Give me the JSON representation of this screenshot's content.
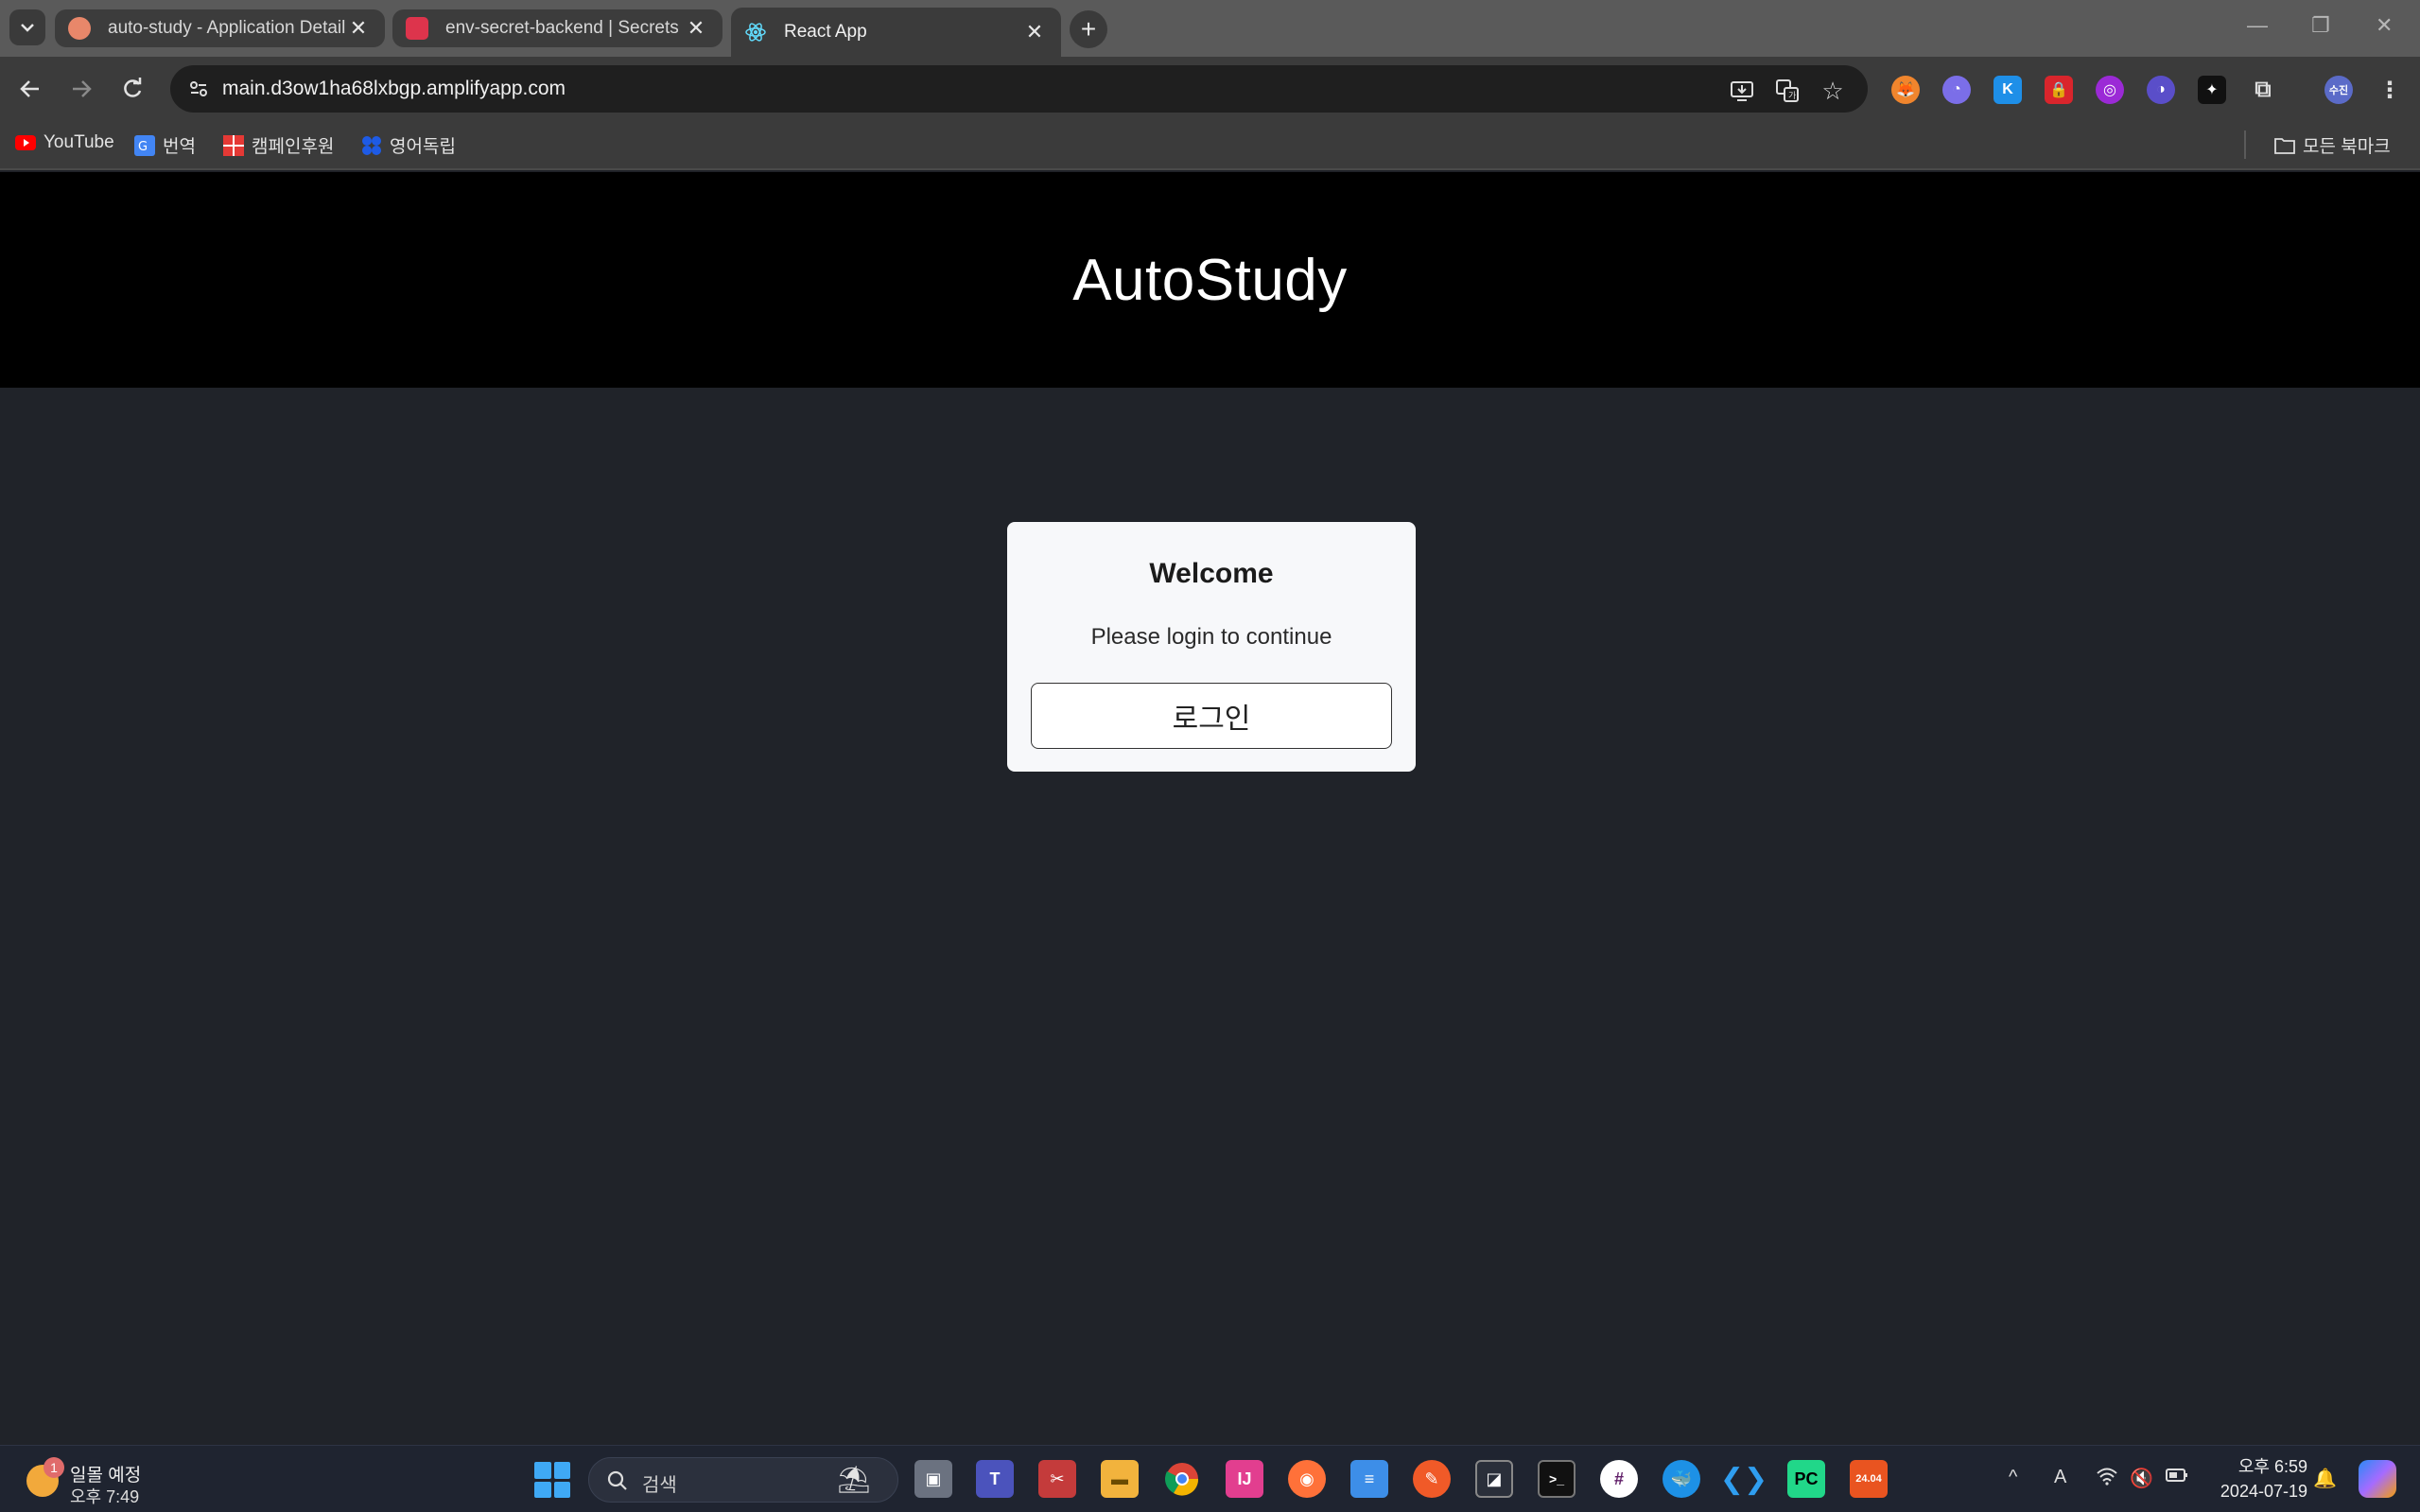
{
  "browser": {
    "tabs": [
      {
        "title": "auto-study - Application Detail",
        "favicon_color": "#e8876a"
      },
      {
        "title": "env-secret-backend | Secrets M",
        "favicon_color": "#dd344c"
      },
      {
        "title": "React App",
        "favicon_color": "#61dafb"
      }
    ],
    "new_tab_symbol": "+",
    "close_symbol": "✕",
    "url": "main.d3ow1ha68lxbgp.amplifyapp.com",
    "profile_label": "수진",
    "bookmarks": [
      {
        "label": "YouTube",
        "icon": "youtube-icon",
        "color": "#ff0000"
      },
      {
        "label": "번역",
        "icon": "google-translate-icon",
        "color": "#4285f4"
      },
      {
        "label": "캠페인후원",
        "icon": "campaign-icon",
        "color": "#e53935"
      },
      {
        "label": "영어독립",
        "icon": "english-app-icon",
        "color": "#1e5be6"
      }
    ],
    "all_bookmarks_label": "모든 북마크"
  },
  "page": {
    "header_title": "AutoStudy",
    "card": {
      "title": "Welcome",
      "subtitle": "Please login to continue",
      "login_button": "로그인"
    },
    "colors": {
      "header_bg": "#000000",
      "body_bg": "#202329",
      "card_bg": "#f7f8fa"
    }
  },
  "taskbar": {
    "notification_count": "1",
    "weather_line1": "일몰 예정",
    "weather_line2": "오후 7:49",
    "search_placeholder": "검색",
    "ubuntu_version": "24.04",
    "time": "오후 6:59",
    "date": "2024-07-19",
    "ime_label": "A"
  }
}
